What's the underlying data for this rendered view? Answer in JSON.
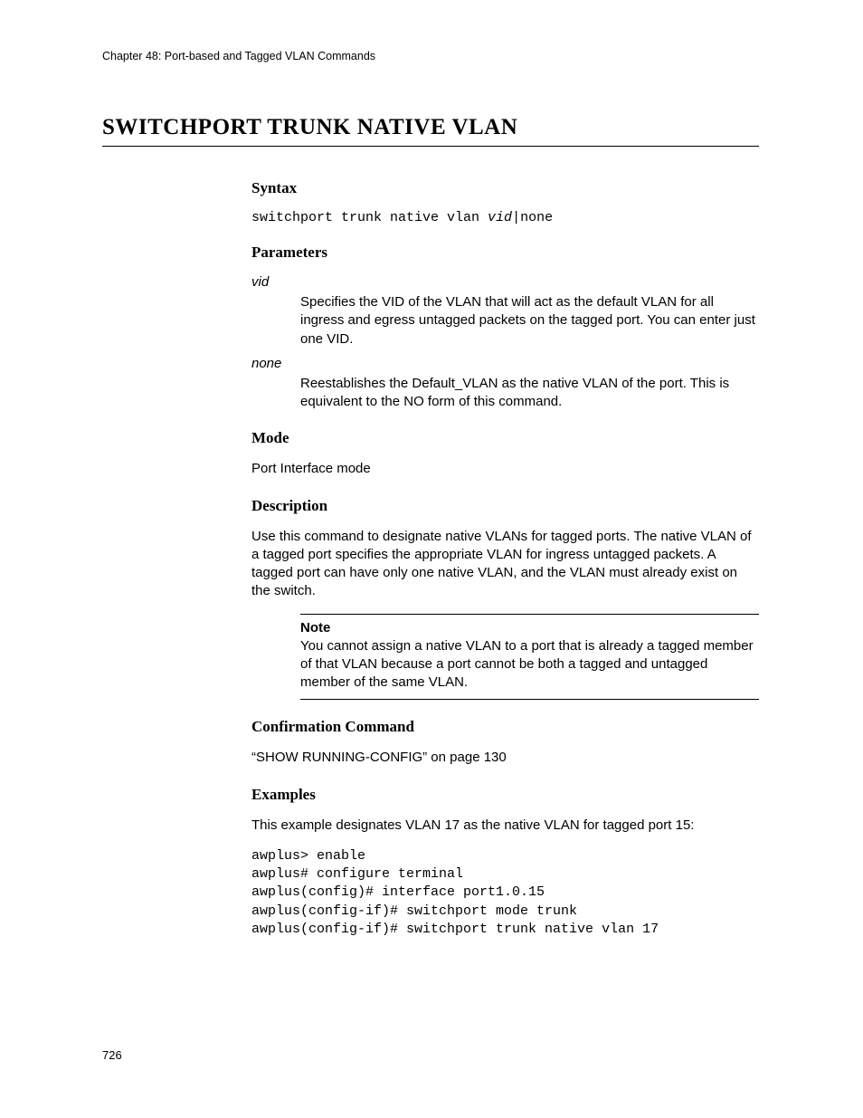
{
  "header": "Chapter 48: Port-based and Tagged VLAN Commands",
  "title": "SWITCHPORT TRUNK NATIVE VLAN",
  "sections": {
    "syntax": {
      "heading": "Syntax",
      "prefix": "switchport trunk native vlan ",
      "arg": "vid",
      "suffix": "|none"
    },
    "parameters": {
      "heading": "Parameters",
      "items": [
        {
          "name": "vid",
          "desc": "Specifies the VID of the VLAN that will act as the default VLAN for all ingress and egress untagged packets on the tagged port. You can enter just one VID."
        },
        {
          "name": "none",
          "desc": "Reestablishes the Default_VLAN as the native VLAN of the port. This is equivalent to the NO form of this command."
        }
      ]
    },
    "mode": {
      "heading": "Mode",
      "text": "Port Interface mode"
    },
    "description": {
      "heading": "Description",
      "text": "Use this command to designate native VLANs for tagged ports. The native VLAN of a tagged port specifies the appropriate VLAN for ingress untagged packets. A tagged port can have only one native VLAN, and the VLAN must already exist on the switch.",
      "note_label": "Note",
      "note_text": "You cannot assign a native VLAN to a port that is already a tagged member of that VLAN because a port cannot be both a tagged and untagged member of the same VLAN."
    },
    "confirmation": {
      "heading": "Confirmation Command",
      "text": "“SHOW RUNNING-CONFIG” on page 130"
    },
    "examples": {
      "heading": "Examples",
      "intro": "This example designates VLAN 17 as the native VLAN for tagged port 15:",
      "code": "awplus> enable\nawplus# configure terminal\nawplus(config)# interface port1.0.15\nawplus(config-if)# switchport mode trunk\nawplus(config-if)# switchport trunk native vlan 17"
    }
  },
  "page_number": "726"
}
